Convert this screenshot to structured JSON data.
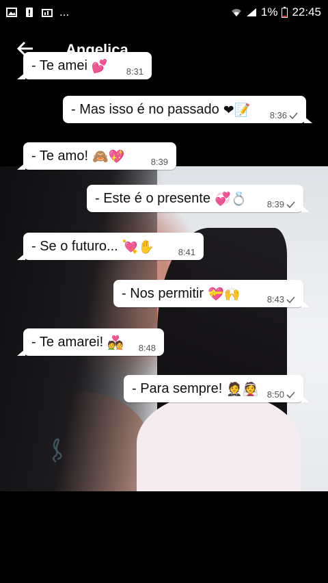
{
  "status_bar": {
    "dots": "...",
    "battery_pct": "1%",
    "time": "22:45"
  },
  "header": {
    "contact_name": "Angelica"
  },
  "messages": [
    {
      "text": "- Te amei",
      "emoji": "💕",
      "time": "8:31",
      "dir": "in"
    },
    {
      "text": "- Mas isso é no passado",
      "emoji": "❤📝",
      "time": "8:36",
      "dir": "out",
      "status": "sent"
    },
    {
      "text": "- Te amo!",
      "emoji": "🙈💖",
      "time": "8:39",
      "dir": "in"
    },
    {
      "text": "- Este é o presente",
      "emoji": "💞💍",
      "time": "8:39",
      "dir": "out",
      "status": "sent"
    },
    {
      "text": "- Se o futuro...",
      "emoji": "💘✋",
      "time": "8:41",
      "dir": "in"
    },
    {
      "text": "- Nos permitir",
      "emoji": "💝🙌",
      "time": "8:43",
      "dir": "out",
      "status": "sent"
    },
    {
      "text": "- Te amarei!",
      "emoji": "💑",
      "time": "8:48",
      "dir": "in"
    },
    {
      "text": "- Para sempre!",
      "emoji": "🤵👰",
      "time": "8:50",
      "dir": "out",
      "status": "sent"
    }
  ],
  "colors": {
    "bubble": "#ffffff",
    "background": "#000000",
    "heart": "#e0245e"
  }
}
